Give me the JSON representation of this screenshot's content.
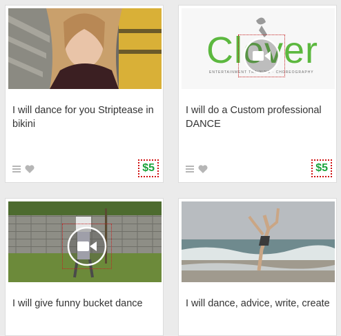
{
  "listings": [
    {
      "title": "I will dance for you Striptease in bikini",
      "price": "$5"
    },
    {
      "title": "I will do a Custom professional DANCE",
      "price": "$5",
      "logo": {
        "brand": "Clover",
        "tagline": "ENTERTAINMENT TRAINING · CHOREOGRAPHY"
      }
    },
    {
      "title": "I will give funny bucket dance"
    },
    {
      "title": "I will dance, advice, write, create"
    }
  ],
  "icons": {
    "menu": "list-icon",
    "favorite": "heart-icon",
    "video": "video-play-icon"
  },
  "colors": {
    "price_text": "#1aa33a",
    "price_border": "#d01010",
    "icon_gray": "#b6b6b6",
    "logo_green": "#5cb83f"
  }
}
